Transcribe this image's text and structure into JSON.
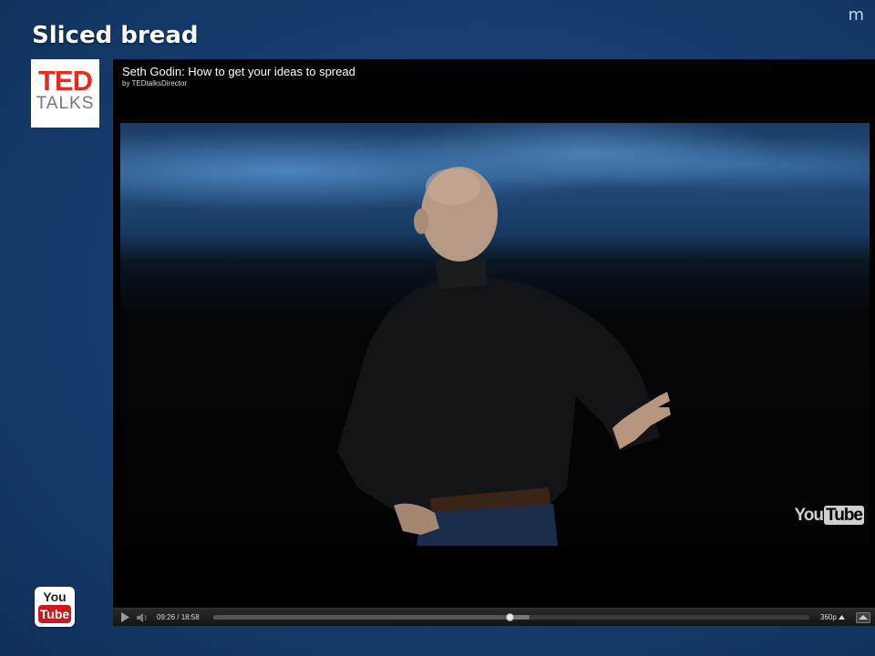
{
  "slide": {
    "title": "Sliced bread",
    "corner_mark": "m"
  },
  "logos": {
    "ted": {
      "word1": "TED",
      "word2": "TALKS"
    },
    "youtube_badge": {
      "word1": "You",
      "word2": "Tube"
    }
  },
  "player": {
    "video_title": "Seth Godin: How to get your ideas to spread",
    "uploader": "by TEDtalksDirector",
    "watermark": {
      "word1": "You",
      "word2": "Tube"
    },
    "controls": {
      "current_time": "09:26",
      "duration": "18:58",
      "time_display": "09:26 / 18:58",
      "quality": "360p",
      "progress_fraction": 0.497,
      "buffered_fraction": 0.53
    },
    "icons": [
      "play-icon",
      "volume-icon",
      "chevron-up-icon",
      "expand-icon"
    ]
  },
  "colors": {
    "ted_red": "#e62b1e",
    "youtube_red": "#cc181e",
    "slide_bg": "#173f73"
  }
}
